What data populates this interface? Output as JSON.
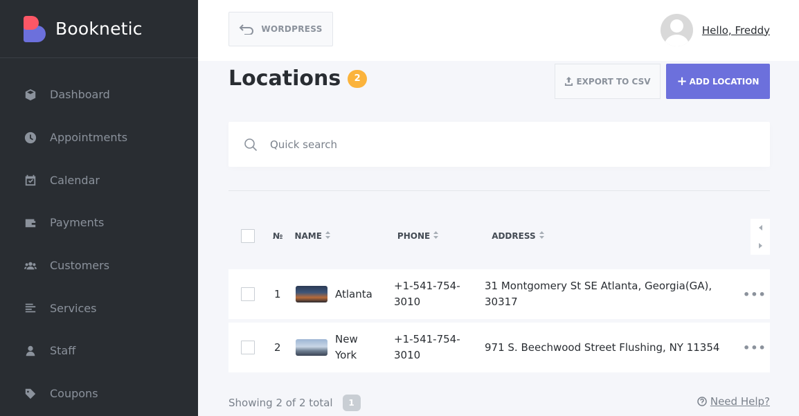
{
  "app": {
    "name": "Booknetic"
  },
  "sidebar": {
    "items": [
      {
        "label": "Dashboard",
        "icon": "cube-icon"
      },
      {
        "label": "Appointments",
        "icon": "clock-icon"
      },
      {
        "label": "Calendar",
        "icon": "calendar-icon"
      },
      {
        "label": "Payments",
        "icon": "wallet-icon"
      },
      {
        "label": "Customers",
        "icon": "users-icon"
      },
      {
        "label": "Services",
        "icon": "list-icon"
      },
      {
        "label": "Staff",
        "icon": "user-icon"
      },
      {
        "label": "Coupons",
        "icon": "tag-icon"
      }
    ]
  },
  "topbar": {
    "wordpress_label": "WORDPRESS",
    "greeting": "Hello, Freddy"
  },
  "page": {
    "title": "Locations",
    "count": "2",
    "export_label": "EXPORT TO CSV",
    "add_label": "ADD LOCATION",
    "add_plus": "+"
  },
  "search": {
    "placeholder": "Quick search"
  },
  "table": {
    "columns": {
      "num": "№",
      "name": "NAME",
      "phone": "PHONE",
      "address": "ADDRESS"
    },
    "rows": [
      {
        "num": "1",
        "name": "Atlanta",
        "phone": "+1-541-754-3010",
        "address": "31 Montgomery St SE Atlanta, Georgia(GA), 30317"
      },
      {
        "num": "2",
        "name": "New York",
        "phone": "+1-541-754-3010",
        "address": "971 S. Beechwood Street Flushing, NY 11354"
      }
    ],
    "more_glyph": "•••"
  },
  "footer": {
    "showing": "Showing 2 of 2 total",
    "page": "1",
    "help": "Need Help?"
  },
  "colors": {
    "accent": "#6c70dc",
    "badge": "#fbb33c",
    "sidebar_bg": "#292d32"
  }
}
